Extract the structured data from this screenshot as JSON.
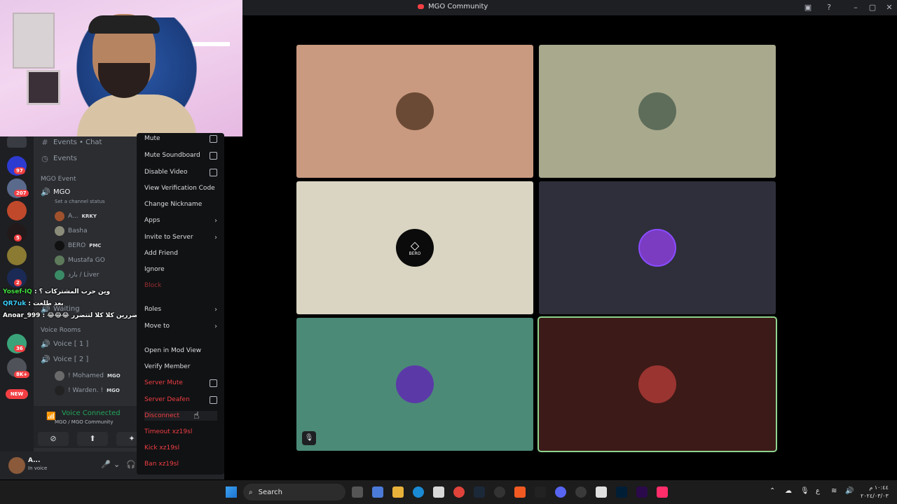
{
  "window": {
    "title": "MGO Community"
  },
  "channels": {
    "top": [
      {
        "label": "Events • Chat"
      },
      {
        "label": "Events"
      }
    ],
    "category_event": "MGO Event",
    "voice_main": {
      "name": "MGO",
      "status_placeholder": "Set a channel status"
    },
    "users_main": [
      {
        "name": "A...",
        "tag": "KRKY"
      },
      {
        "name": "Basha",
        "tag": ""
      },
      {
        "name": "BERO",
        "tag": "PMC"
      },
      {
        "name": "Mustafa GO",
        "tag": ""
      },
      {
        "name": "بارد / Liver",
        "tag": ""
      }
    ],
    "waiting": "Waiting",
    "category_voice": "Voice Rooms",
    "voice_rooms": [
      {
        "name": "Voice [ 1 ]"
      },
      {
        "name": "Voice [ 2 ]"
      }
    ],
    "users_voice2": [
      {
        "name": "! Mohamed",
        "tag": "MGO"
      },
      {
        "name": "! Warden. !",
        "tag": "MGO"
      }
    ]
  },
  "chat_overlay": [
    {
      "user": "Yosef-IQ",
      "text": ": وين حرب المشتركات ؟",
      "color": "#42e042"
    },
    {
      "user": "QR7uk",
      "text": ": بعد طلعت",
      "color": "#3ad0ff"
    },
    {
      "user": "Anoar_999",
      "text": ": 😂😂😂 لا احنه مو متضررين كلا كلا لتتضرر 😂😂😂",
      "color": "#ffffff"
    }
  ],
  "rail_badges": [
    "97",
    "207",
    "5",
    "2",
    "36",
    "8K+"
  ],
  "rail_new": "NEW",
  "voice_panel": {
    "title": "Voice Connected",
    "subtitle": "MGO / MGO Community"
  },
  "user_panel": {
    "name": "A...",
    "status": "In voice"
  },
  "context_menu": [
    {
      "label": "Mute",
      "kind": "check"
    },
    {
      "label": "Mute Soundboard",
      "kind": "check"
    },
    {
      "label": "Disable Video",
      "kind": "check"
    },
    {
      "label": "View Verification Code",
      "kind": "plain"
    },
    {
      "label": "Change Nickname",
      "kind": "plain"
    },
    {
      "label": "Apps",
      "kind": "submenu"
    },
    {
      "label": "Invite to Server",
      "kind": "submenu"
    },
    {
      "label": "Add Friend",
      "kind": "plain"
    },
    {
      "label": "Ignore",
      "kind": "plain"
    },
    {
      "label": "Block",
      "kind": "danger"
    },
    {
      "label": "Roles",
      "kind": "submenu"
    },
    {
      "label": "Move to",
      "kind": "submenu"
    },
    {
      "label": "Open in Mod View",
      "kind": "plain"
    },
    {
      "label": "Verify Member",
      "kind": "plain"
    },
    {
      "label": "Server Mute",
      "kind": "danger-check"
    },
    {
      "label": "Server Deafen",
      "kind": "danger-check"
    },
    {
      "label": "Disconnect",
      "kind": "danger"
    },
    {
      "label": "Timeout xz19sl",
      "kind": "danger"
    },
    {
      "label": "Kick xz19sl",
      "kind": "danger"
    },
    {
      "label": "Ban xz19sl",
      "kind": "danger"
    }
  ],
  "tiles": [
    {
      "bg": "#c99a80",
      "avatar": "#6b4a35",
      "label": ""
    },
    {
      "bg": "#a9a98d",
      "avatar": "#5d6d5a",
      "label": ""
    },
    {
      "bg": "#d9d5c2",
      "avatar": "#0b0b0b",
      "label": "BERO"
    },
    {
      "bg": "#2e2f3a",
      "avatar": "#7b3cc2",
      "label": ""
    },
    {
      "bg": "#4b8a77",
      "avatar": "#5b3aa8",
      "label": ""
    },
    {
      "bg": "#3c1a17",
      "avatar": "#9a3430",
      "label": ""
    }
  ],
  "taskbar": {
    "search_placeholder": "Search",
    "time": "١٠:٤٤ م",
    "date": "٢٠٢٤/٠٣/٠٣"
  },
  "colors": {
    "accent_red": "#f23f43",
    "voice_green": "#23a55a",
    "speaking_outline": "#8fd48f"
  }
}
